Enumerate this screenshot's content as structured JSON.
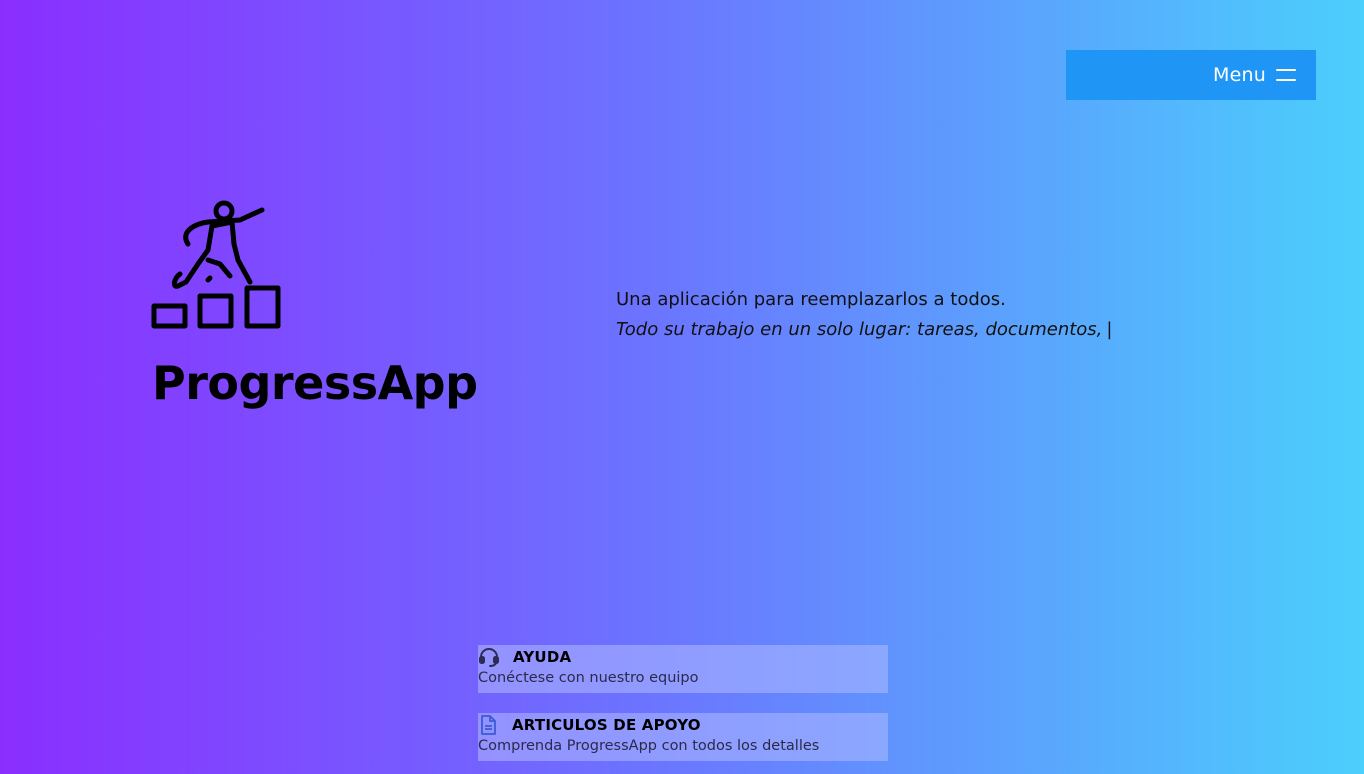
{
  "header": {
    "menu_label": "Menu",
    "menu_icon": "hamburger-icon"
  },
  "hero": {
    "logo_icon": "person-climbing-steps-icon",
    "app_title": "ProgressApp",
    "tagline_line1": "Una aplicación para reemplazarlos a todos.",
    "tagline_line2": "Todo su trabajo en un solo lugar: tareas, documentos,",
    "cursor": "|"
  },
  "support_cards": [
    {
      "icon": "headset-icon",
      "title": "AYUDA",
      "description": "Conéctese con nuestro equipo"
    },
    {
      "icon": "document-icon",
      "title": "ARTICULOS DE APOYO",
      "description": "Comprenda ProgressApp con todos los detalles"
    }
  ],
  "colors": {
    "gradient_start": "#8a2eff",
    "gradient_mid": "#6a78ff",
    "gradient_end": "#4bcffc",
    "menu_button": "#1f95f5",
    "card_background": "#afb9ff"
  }
}
